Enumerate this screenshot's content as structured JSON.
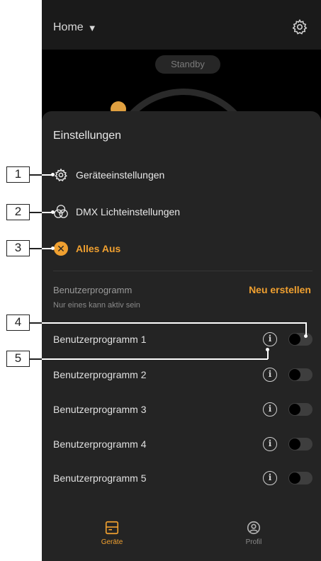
{
  "topbar": {
    "home_label": "Home",
    "caret": "▼"
  },
  "status": {
    "standby": "Standby"
  },
  "sheet": {
    "title": "Einstellungen",
    "menu": [
      {
        "label": "Geräteeinstellungen",
        "icon": "gear-icon"
      },
      {
        "label": "DMX Lichteinstellungen",
        "icon": "rgb-circles-icon"
      },
      {
        "label": "Alles Aus",
        "icon": "close-circle-icon"
      }
    ],
    "programs_header": "Benutzerprogramm",
    "programs_sub": "Nur eines kann aktiv sein",
    "new_button": "Neu erstellen",
    "programs": [
      {
        "label": "Benutzerprogramm 1",
        "enabled": false
      },
      {
        "label": "Benutzerprogramm 2",
        "enabled": false
      },
      {
        "label": "Benutzerprogramm 3",
        "enabled": false
      },
      {
        "label": "Benutzerprogramm 4",
        "enabled": false
      },
      {
        "label": "Benutzerprogramm 5",
        "enabled": false
      }
    ],
    "info_glyph": "i"
  },
  "nav": {
    "geraete": "Geräte",
    "profil": "Profil"
  },
  "callouts": [
    "1",
    "2",
    "3",
    "4",
    "5"
  ],
  "colors": {
    "accent": "#f0a030",
    "sheet": "#242424",
    "background": "#000000"
  }
}
